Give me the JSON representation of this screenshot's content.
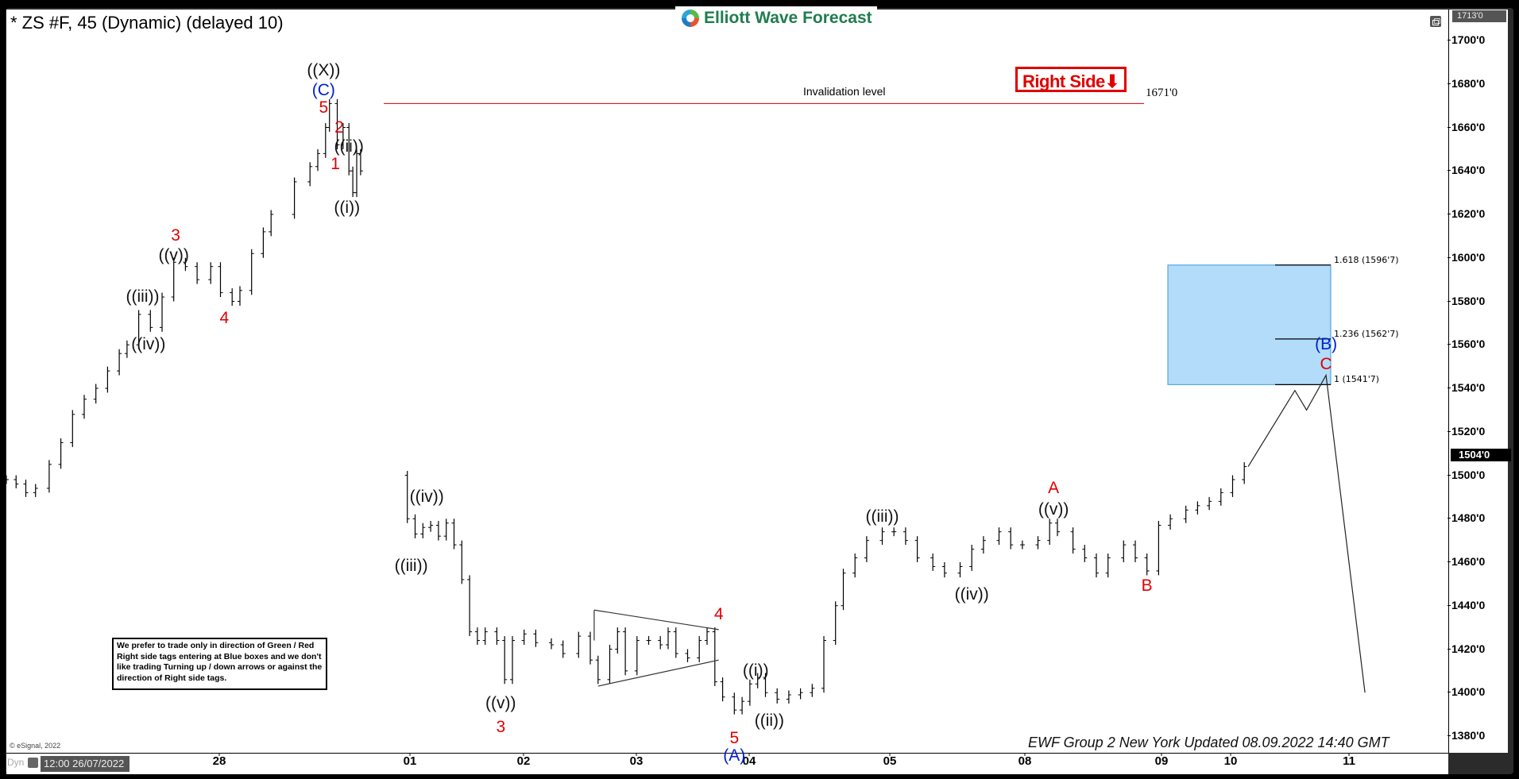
{
  "window": {
    "title": "* ZS #F, 45 (Dynamic) (delayed 10)",
    "brand": "Elliott Wave Forecast",
    "copyright": "© eSignal, 2022",
    "mode_label": "Dyn",
    "cursor_date": "12:00 26/07/2022",
    "footer": "EWF Group 2 New York Updated 08.09.2022 14:40 GMT",
    "note": "We prefer to trade only in direction of Green / Red Right side tags entering at Blue boxes and we don't like trading Turning up / down arrows or against the direction of Right side tags.",
    "right_side_tag": "Right Side",
    "right_side_arrow": "⬇"
  },
  "chart_data": {
    "type": "bar",
    "title": "* ZS #F, 45 (Dynamic) (delayed 10)",
    "symbol": "ZS #F",
    "interval": "45",
    "xlabel": "",
    "ylabel": "",
    "ylim": [
      1370,
      1713
    ],
    "y_ticks": [
      "1700'0",
      "1680'0",
      "1660'0",
      "1640'0",
      "1620'0",
      "1600'0",
      "1580'0",
      "1560'0",
      "1540'0",
      "1520'0",
      "1500'0",
      "1480'0",
      "1460'0",
      "1440'0",
      "1420'0",
      "1400'0",
      "1380'0"
    ],
    "y_tick_values": [
      1700,
      1680,
      1660,
      1640,
      1620,
      1600,
      1580,
      1560,
      1540,
      1520,
      1500,
      1480,
      1460,
      1440,
      1420,
      1400,
      1380
    ],
    "x_ticks": [
      "28",
      "01",
      "02",
      "03",
      "04",
      "05",
      "08",
      "09",
      "10",
      "11"
    ],
    "x_tick_index": [
      1,
      2,
      3,
      4,
      5,
      6,
      7,
      8,
      9,
      10
    ],
    "price_scale_top": "1713'0",
    "last_price": "1504'0",
    "invalidation": {
      "label": "Invalidation level",
      "value": 1671,
      "value_label": "1671'0",
      "color": "#cc0000"
    },
    "blue_box": {
      "from": 1541.7,
      "to": 1596.7,
      "color": "#b3dcfa"
    },
    "fib_levels": [
      {
        "ratio": "1.618",
        "price": 1596.7,
        "label": "1.618 (1596'7)"
      },
      {
        "ratio": "1.236",
        "price": 1562.7,
        "label": "1.236 (1562'7)"
      },
      {
        "ratio": "1",
        "price": 1541.7,
        "label": "1 (1541'7)"
      }
    ],
    "price_path": [
      [
        0.0,
        1498
      ],
      [
        0.05,
        1496
      ],
      [
        0.1,
        1492
      ],
      [
        0.15,
        1494
      ],
      [
        0.22,
        1505
      ],
      [
        0.28,
        1515
      ],
      [
        0.34,
        1528
      ],
      [
        0.4,
        1535
      ],
      [
        0.46,
        1540
      ],
      [
        0.52,
        1548
      ],
      [
        0.58,
        1556
      ],
      [
        0.62,
        1560
      ],
      [
        0.68,
        1574
      ],
      [
        0.74,
        1568
      ],
      [
        0.8,
        1582
      ],
      [
        0.86,
        1598
      ],
      [
        0.92,
        1596
      ],
      [
        0.98,
        1590
      ],
      [
        1.05,
        1596
      ],
      [
        1.1,
        1584
      ],
      [
        1.16,
        1580
      ],
      [
        1.2,
        1585
      ],
      [
        1.26,
        1602
      ],
      [
        1.32,
        1612
      ],
      [
        1.36,
        1620
      ],
      [
        1.48,
        1635
      ],
      [
        1.56,
        1642
      ],
      [
        1.6,
        1648
      ],
      [
        1.64,
        1660
      ],
      [
        1.66,
        1671
      ],
      [
        1.7,
        1652
      ],
      [
        1.73,
        1660
      ],
      [
        1.76,
        1640
      ],
      [
        1.78,
        1630
      ],
      [
        1.8,
        1648
      ],
      [
        1.82,
        1640
      ],
      [
        2.02,
        1500
      ],
      [
        2.06,
        1480
      ],
      [
        2.1,
        1473
      ],
      [
        2.14,
        1476
      ],
      [
        2.18,
        1477
      ],
      [
        2.22,
        1472
      ],
      [
        2.26,
        1478
      ],
      [
        2.3,
        1468
      ],
      [
        2.34,
        1452
      ],
      [
        2.38,
        1428
      ],
      [
        2.42,
        1424
      ],
      [
        2.46,
        1428
      ],
      [
        2.52,
        1424
      ],
      [
        2.56,
        1406
      ],
      [
        2.6,
        1424
      ],
      [
        2.66,
        1427
      ],
      [
        2.72,
        1423
      ],
      [
        2.8,
        1422
      ],
      [
        2.86,
        1418
      ],
      [
        2.94,
        1426
      ],
      [
        3.0,
        1415
      ],
      [
        3.04,
        1406
      ],
      [
        3.1,
        1420
      ],
      [
        3.14,
        1428
      ],
      [
        3.18,
        1410
      ],
      [
        3.24,
        1424
      ],
      [
        3.3,
        1424
      ],
      [
        3.36,
        1422
      ],
      [
        3.4,
        1428
      ],
      [
        3.44,
        1418
      ],
      [
        3.5,
        1416
      ],
      [
        3.56,
        1424
      ],
      [
        3.6,
        1428
      ],
      [
        3.64,
        1405
      ],
      [
        3.68,
        1398
      ],
      [
        3.74,
        1392
      ],
      [
        3.78,
        1396
      ],
      [
        3.82,
        1404
      ],
      [
        3.86,
        1407
      ],
      [
        3.9,
        1400
      ],
      [
        3.96,
        1397
      ],
      [
        4.02,
        1399
      ],
      [
        4.08,
        1400
      ],
      [
        4.14,
        1402
      ],
      [
        4.2,
        1424
      ],
      [
        4.26,
        1440
      ],
      [
        4.3,
        1455
      ],
      [
        4.36,
        1462
      ],
      [
        4.42,
        1470
      ],
      [
        4.5,
        1474
      ],
      [
        4.56,
        1474
      ],
      [
        4.62,
        1470
      ],
      [
        4.68,
        1462
      ],
      [
        4.76,
        1458
      ],
      [
        4.82,
        1455
      ],
      [
        4.9,
        1458
      ],
      [
        4.96,
        1466
      ],
      [
        5.02,
        1470
      ],
      [
        5.1,
        1474
      ],
      [
        5.16,
        1468
      ],
      [
        5.22,
        1468
      ],
      [
        5.3,
        1470
      ],
      [
        5.36,
        1478
      ],
      [
        5.4,
        1474
      ],
      [
        5.48,
        1466
      ],
      [
        5.54,
        1462
      ],
      [
        5.6,
        1455
      ],
      [
        5.66,
        1462
      ],
      [
        5.74,
        1468
      ],
      [
        5.8,
        1462
      ],
      [
        5.86,
        1456
      ],
      [
        5.92,
        1477
      ],
      [
        5.98,
        1480
      ],
      [
        6.06,
        1484
      ],
      [
        6.12,
        1486
      ],
      [
        6.18,
        1488
      ],
      [
        6.24,
        1492
      ],
      [
        6.3,
        1498
      ],
      [
        6.36,
        1504
      ]
    ],
    "projection": [
      [
        6.38,
        1504
      ],
      [
        6.62,
        1539
      ],
      [
        6.68,
        1530
      ],
      [
        6.78,
        1546
      ],
      [
        6.98,
        1400
      ]
    ],
    "triangle": [
      [
        3.02,
        1438
      ],
      [
        3.66,
        1429
      ],
      [
        3.66,
        1415
      ],
      [
        3.04,
        1403
      ]
    ],
    "wave_labels": [
      {
        "text": "((X))",
        "x": 1.63,
        "price": 1686,
        "color": "black"
      },
      {
        "text": "(C)",
        "x": 1.63,
        "price": 1677,
        "color": "blue"
      },
      {
        "text": "5",
        "x": 1.63,
        "price": 1669,
        "color": "red"
      },
      {
        "text": "2",
        "x": 1.71,
        "price": 1660,
        "color": "red"
      },
      {
        "text": "((ii))",
        "x": 1.76,
        "price": 1651,
        "color": "black"
      },
      {
        "text": "1",
        "x": 1.69,
        "price": 1643,
        "color": "red"
      },
      {
        "text": "((i))",
        "x": 1.75,
        "price": 1623,
        "color": "black"
      },
      {
        "text": "3",
        "x": 0.87,
        "price": 1610,
        "color": "red"
      },
      {
        "text": "((v))",
        "x": 0.86,
        "price": 1601,
        "color": "black"
      },
      {
        "text": "((iii))",
        "x": 0.7,
        "price": 1582,
        "color": "black"
      },
      {
        "text": "((iv))",
        "x": 0.73,
        "price": 1560,
        "color": "black"
      },
      {
        "text": "4",
        "x": 1.12,
        "price": 1572,
        "color": "red"
      },
      {
        "text": "((iv))",
        "x": 2.16,
        "price": 1490,
        "color": "black"
      },
      {
        "text": "((iii))",
        "x": 2.08,
        "price": 1458,
        "color": "black"
      },
      {
        "text": "((v))",
        "x": 2.54,
        "price": 1395,
        "color": "black"
      },
      {
        "text": "3",
        "x": 2.54,
        "price": 1384,
        "color": "red"
      },
      {
        "text": "4",
        "x": 3.66,
        "price": 1436,
        "color": "red"
      },
      {
        "text": "((i))",
        "x": 3.85,
        "price": 1410,
        "color": "black"
      },
      {
        "text": "((ii))",
        "x": 3.92,
        "price": 1387,
        "color": "black"
      },
      {
        "text": "5",
        "x": 3.74,
        "price": 1379,
        "color": "red"
      },
      {
        "text": "(A)",
        "x": 3.74,
        "price": 1371,
        "color": "blue"
      },
      {
        "text": "((iii))",
        "x": 4.5,
        "price": 1481,
        "color": "black"
      },
      {
        "text": "((iv))",
        "x": 4.96,
        "price": 1445,
        "color": "black"
      },
      {
        "text": "A",
        "x": 5.38,
        "price": 1494,
        "color": "red"
      },
      {
        "text": "((v))",
        "x": 5.38,
        "price": 1484,
        "color": "black"
      },
      {
        "text": "B",
        "x": 5.86,
        "price": 1449,
        "color": "red"
      },
      {
        "text": "(B)",
        "x": 6.78,
        "price": 1560,
        "color": "blue"
      },
      {
        "text": "C",
        "x": 6.78,
        "price": 1551,
        "color": "red"
      }
    ]
  }
}
